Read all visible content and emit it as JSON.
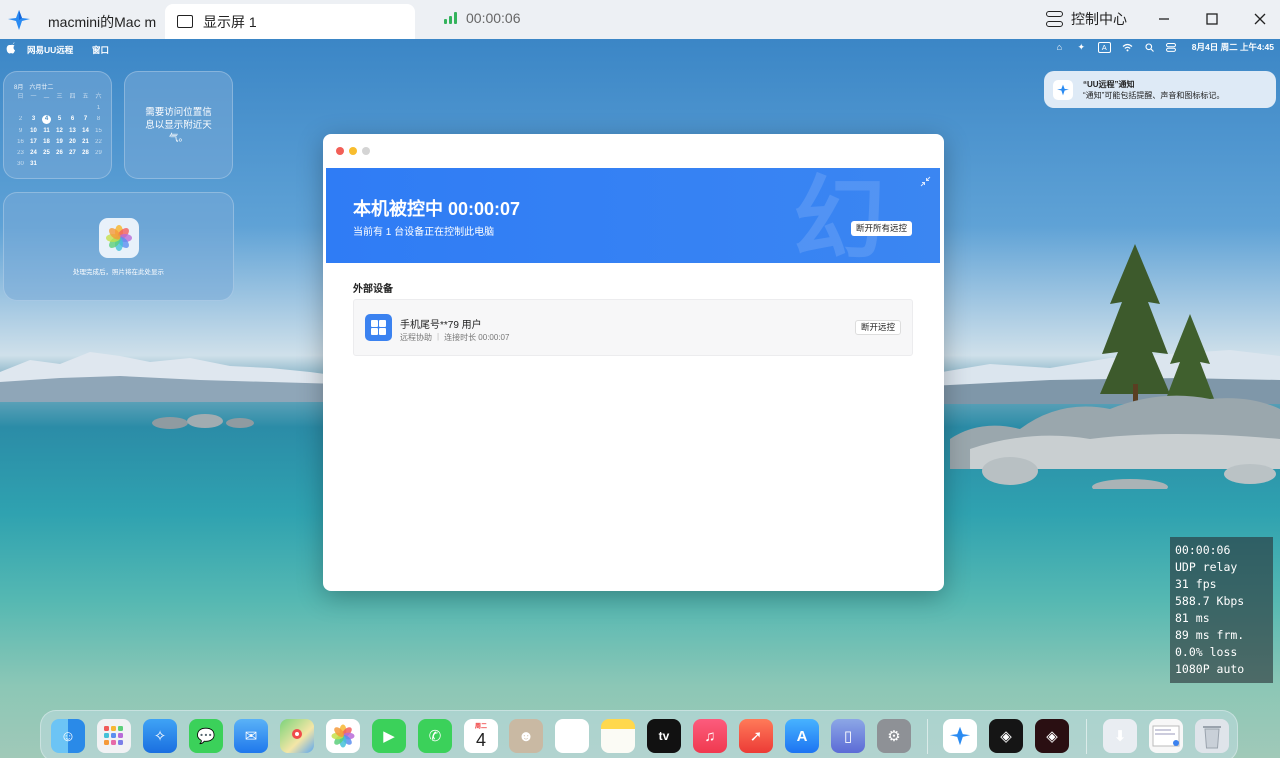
{
  "client": {
    "tabs": [
      {
        "label": "macmini的Mac m"
      },
      {
        "label": "显示屏 1"
      }
    ],
    "session_timer": "00:00:06",
    "control_center_label": "控制中心"
  },
  "mac_menubar": {
    "app_name": "网易UU远程",
    "window_menu": "窗口",
    "datetime": "8月4日 周二 上午4:45"
  },
  "calendar_widget": {
    "header": [
      "8月",
      "六月廿二"
    ],
    "weekdays": [
      "日",
      "一",
      "二",
      "三",
      "四",
      "五",
      "六"
    ],
    "days": [
      "",
      "",
      "",
      "",
      "",
      "",
      "1",
      "2",
      "3",
      "4",
      "5",
      "6",
      "7",
      "8",
      "9",
      "10",
      "11",
      "12",
      "13",
      "14",
      "15",
      "16",
      "17",
      "18",
      "19",
      "20",
      "21",
      "22",
      "23",
      "24",
      "25",
      "26",
      "27",
      "28",
      "29",
      "30",
      "31"
    ],
    "today": "4"
  },
  "weather_widget": {
    "text": "需要访问位置信息以显示附近天气。"
  },
  "photos_widget": {
    "text": "处理完成后，照片将在此处显示"
  },
  "notification": {
    "title": "“UU远程”通知",
    "body": "“通知”可能包括提醒、声音和图标标记。"
  },
  "uu_window": {
    "status_title": "本机被控中 00:00:07",
    "status_subtitle": "当前有 1 台设备正在控制此电脑",
    "disconnect_all_label": "断开所有远控",
    "section_title": "外部设备",
    "device": {
      "name": "手机尾号**79 用户",
      "type": "远程协助",
      "duration": "连接时长 00:00:07",
      "disconnect_label": "断开远控"
    }
  },
  "stats_overlay": [
    "00:00:06",
    "UDP relay",
    "31 fps",
    "588.7 Kbps",
    "81 ms",
    "89 ms frm.",
    "0.0% loss",
    "1080P auto"
  ],
  "dock": {
    "apps": [
      "finder-icon",
      "launchpad-icon",
      "safari-icon",
      "messages-icon",
      "mail-icon",
      "maps-icon",
      "photos-icon",
      "facetime-icon",
      "phone-icon",
      "calendar-icon",
      "contacts-icon",
      "reminders-icon",
      "notes-icon",
      "appletv-icon",
      "music-icon",
      "rocket-icon",
      "appstore-icon",
      "iphone-mirroring-icon",
      "settings-icon",
      "uu-remote-icon",
      "app-dark-icon",
      "app-red-icon",
      "downloads-icon",
      "screenshot-icon",
      "trash-icon"
    ],
    "calendar_day": "4",
    "calendar_weekday": "周二",
    "tv_label": "tv"
  },
  "colors": {
    "accent": "#2f7cf5",
    "signal": "#34b35c"
  }
}
